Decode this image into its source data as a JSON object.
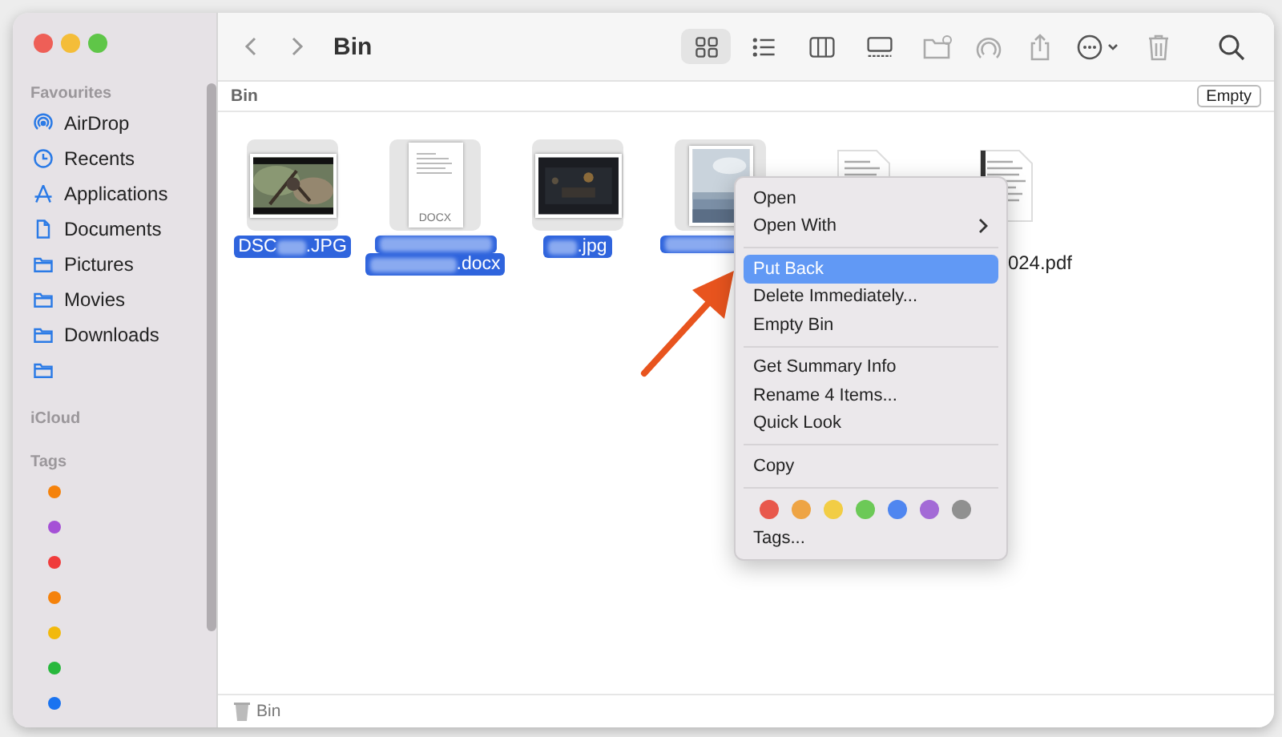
{
  "window": {
    "title": "Bin"
  },
  "sidebar": {
    "sections": [
      {
        "heading": "Favourites",
        "items": [
          {
            "kind": "airdrop",
            "label": "AirDrop"
          },
          {
            "kind": "clock",
            "label": "Recents"
          },
          {
            "kind": "apps",
            "label": "Applications"
          },
          {
            "kind": "doc",
            "label": "Documents"
          },
          {
            "kind": "folder",
            "label": "Pictures"
          },
          {
            "kind": "folder",
            "label": "Movies"
          },
          {
            "kind": "folder",
            "label": "Downloads"
          },
          {
            "kind": "folder"
          }
        ]
      },
      {
        "heading": "iCloud"
      },
      {
        "heading": "Tags",
        "tags": [
          {
            "color": "#f5820b"
          },
          {
            "color": "#a550d6"
          },
          {
            "color": "#f03c3c"
          },
          {
            "color": "#f5820b"
          },
          {
            "color": "#f2b90c"
          },
          {
            "color": "#28b83c"
          },
          {
            "color": "#1a73f0"
          }
        ]
      }
    ]
  },
  "toolbar": {
    "views": [
      {
        "kind": "icons",
        "selected": true
      },
      {
        "kind": "list",
        "selected": false
      },
      {
        "kind": "columns",
        "selected": false
      },
      {
        "kind": "gallery",
        "selected": false
      }
    ]
  },
  "path_bar": {
    "label": "Bin",
    "button": "Empty"
  },
  "files": [
    {
      "selected": true,
      "lines": [
        [
          {
            "kind": "text",
            "text": "DSC"
          },
          {
            "kind": "redacted"
          },
          {
            "kind": "text",
            "text": ".JPG"
          }
        ]
      ]
    },
    {
      "kind": "doc",
      "badge": "DOCX",
      "selected": true,
      "lines": [
        [
          {
            "kind": "redacted"
          }
        ],
        [
          {
            "kind": "redacted"
          },
          {
            "kind": "text",
            "text": ".docx"
          }
        ]
      ]
    },
    {
      "kind": "dark-photo",
      "selected": true,
      "lines": [
        [
          {
            "kind": "redacted"
          },
          {
            "kind": "text",
            "text": ".jpg"
          }
        ]
      ]
    },
    {
      "kind": "sky-photo",
      "selected": true,
      "lines": [
        [
          {
            "kind": "redacted"
          }
        ]
      ]
    },
    {
      "kind": "page",
      "selected": false
    },
    {
      "kind": "page",
      "selected": false,
      "label_clipped": true,
      "lines": [
        [
          {
            "kind": "text",
            "text": "024.pdf"
          }
        ]
      ]
    }
  ],
  "status_bar": {
    "label": "Bin"
  },
  "context_menu": {
    "sections": [
      {
        "items": [
          {
            "label": "Open",
            "selected": false,
            "submenu": false
          },
          {
            "label": "Open With",
            "selected": false,
            "submenu": true
          }
        ]
      },
      {
        "items": [
          {
            "label": "Put Back",
            "selected": true,
            "submenu": false
          },
          {
            "label": "Delete Immediately...",
            "selected": false,
            "submenu": false
          },
          {
            "label": "Empty Bin",
            "selected": false,
            "submenu": false
          }
        ]
      },
      {
        "items": [
          {
            "label": "Get Summary Info",
            "selected": false,
            "submenu": false
          },
          {
            "label": "Rename 4 Items...",
            "selected": false,
            "submenu": false
          },
          {
            "label": "Quick Look",
            "selected": false,
            "submenu": false
          }
        ]
      },
      {
        "items": [
          {
            "label": "Copy",
            "selected": false,
            "submenu": false
          }
        ]
      },
      {
        "tags": [
          {
            "color": "#e8584c"
          },
          {
            "color": "#eea444"
          },
          {
            "color": "#f2cd45"
          },
          {
            "color": "#6cc957"
          },
          {
            "color": "#4f86f0"
          },
          {
            "color": "#a36ad6"
          },
          {
            "color": "#909090"
          }
        ],
        "items": [
          {
            "label": "Tags...",
            "selected": false,
            "submenu": false
          }
        ]
      }
    ]
  }
}
